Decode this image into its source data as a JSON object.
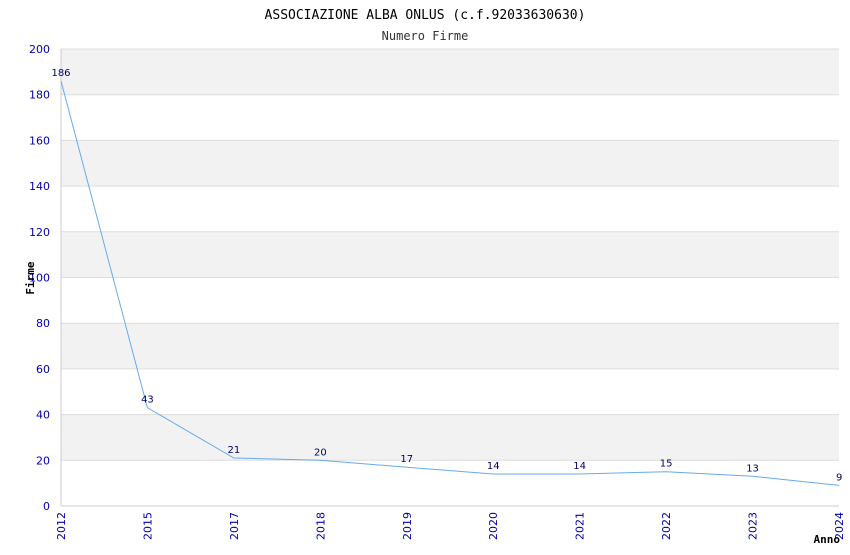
{
  "chart_data": {
    "type": "line",
    "title": "ASSOCIAZIONE ALBA ONLUS (c.f.92033630630)",
    "subtitle": "Numero Firme",
    "xlabel": "Anno",
    "ylabel": "Firme",
    "categories": [
      "2012",
      "2015",
      "2017",
      "2018",
      "2019",
      "2020",
      "2021",
      "2022",
      "2023",
      "2024"
    ],
    "series": [
      {
        "values": [
          186,
          43,
          21,
          20,
          17,
          14,
          14,
          15,
          13,
          9
        ]
      }
    ],
    "data_labels": [
      "186",
      "43",
      "21",
      "20",
      "17",
      "14",
      "14",
      "15",
      "13",
      "9"
    ],
    "ylim": [
      0,
      200
    ],
    "yticks": [
      0,
      20,
      40,
      60,
      80,
      100,
      120,
      140,
      160,
      180,
      200
    ],
    "grid": true,
    "legend": "none"
  },
  "colors": {
    "line": "#66aaee",
    "band": "#f2f2f2",
    "gridline": "#dddddd",
    "tick_text": "#0000aa",
    "data_label": "#000066"
  }
}
